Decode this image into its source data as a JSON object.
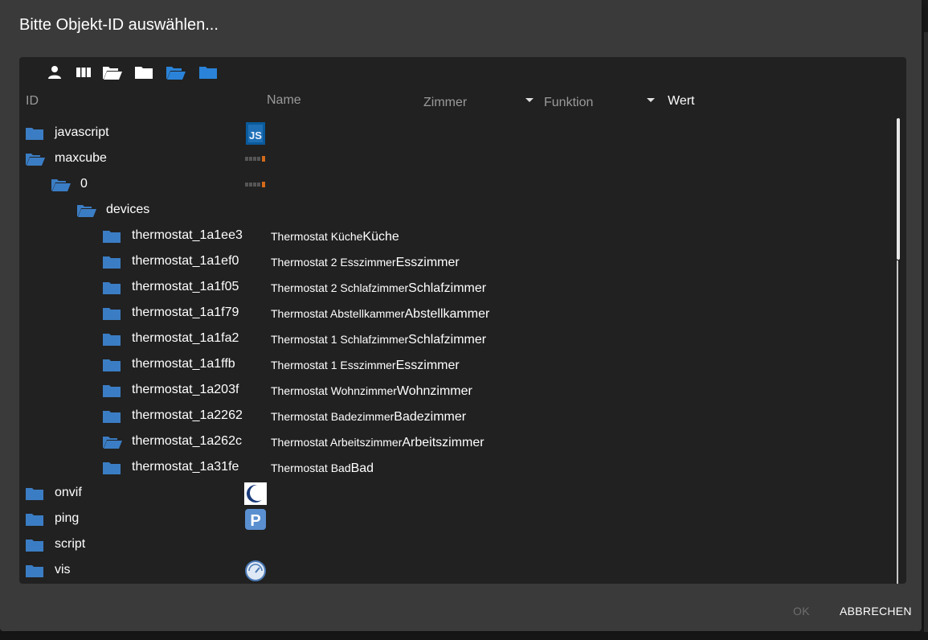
{
  "dialog": {
    "title": "Bitte Objekt-ID auswählen...",
    "ok_label": "OK",
    "cancel_label": "ABBRECHEN"
  },
  "toolbar": {
    "buttons": [
      "person-icon",
      "columns-icon",
      "folder-open-icon",
      "folder-icon",
      "folder-open-blue-icon",
      "folder-blue-icon"
    ]
  },
  "columns": {
    "id": "ID",
    "name": "Name",
    "room": "Zimmer",
    "function": "Funktion",
    "value": "Wert"
  },
  "tree": [
    {
      "id": "javascript",
      "depth": 0,
      "open": false,
      "name": "",
      "room": "",
      "icon": "js-icon"
    },
    {
      "id": "maxcube",
      "depth": 0,
      "open": true,
      "name": "",
      "room": "",
      "icon": "maxcube-icon"
    },
    {
      "id": "0",
      "depth": 1,
      "open": true,
      "name": "",
      "room": "",
      "icon": "maxcube-icon"
    },
    {
      "id": "devices",
      "depth": 2,
      "open": true,
      "name": "",
      "room": "",
      "icon": ""
    },
    {
      "id": "thermostat_1a1ee3",
      "depth": 3,
      "open": false,
      "name": "Thermostat Küche",
      "room": "Küche",
      "icon": ""
    },
    {
      "id": "thermostat_1a1ef0",
      "depth": 3,
      "open": false,
      "name": "Thermostat 2 Esszimmer",
      "room": "Esszimmer",
      "icon": ""
    },
    {
      "id": "thermostat_1a1f05",
      "depth": 3,
      "open": false,
      "name": "Thermostat 2 Schlafzimmer",
      "room": "Schlafzimmer",
      "icon": ""
    },
    {
      "id": "thermostat_1a1f79",
      "depth": 3,
      "open": false,
      "name": "Thermostat Abstellkammer",
      "room": "Abstellkammer",
      "icon": ""
    },
    {
      "id": "thermostat_1a1fa2",
      "depth": 3,
      "open": false,
      "name": "Thermostat 1 Schlafzimmer",
      "room": "Schlafzimmer",
      "icon": ""
    },
    {
      "id": "thermostat_1a1ffb",
      "depth": 3,
      "open": false,
      "name": "Thermostat 1 Esszimmer",
      "room": "Esszimmer",
      "icon": ""
    },
    {
      "id": "thermostat_1a203f",
      "depth": 3,
      "open": false,
      "name": "Thermostat Wohnzimmer",
      "room": "Wohnzimmer",
      "icon": ""
    },
    {
      "id": "thermostat_1a2262",
      "depth": 3,
      "open": false,
      "name": "Thermostat Badezimmer",
      "room": "Badezimmer",
      "icon": ""
    },
    {
      "id": "thermostat_1a262c",
      "depth": 3,
      "open": true,
      "name": "Thermostat Arbeitszimmer",
      "room": "Arbeitszimmer",
      "icon": ""
    },
    {
      "id": "thermostat_1a31fe",
      "depth": 3,
      "open": false,
      "name": "Thermostat Bad",
      "room": "Bad",
      "icon": ""
    },
    {
      "id": "onvif",
      "depth": 0,
      "open": false,
      "name": "",
      "room": "",
      "icon": "onvif-icon"
    },
    {
      "id": "ping",
      "depth": 0,
      "open": false,
      "name": "",
      "room": "",
      "icon": "ping-icon"
    },
    {
      "id": "script",
      "depth": 0,
      "open": false,
      "name": "",
      "room": "",
      "icon": ""
    },
    {
      "id": "vis",
      "depth": 0,
      "open": false,
      "name": "",
      "room": "",
      "icon": "vis-icon"
    }
  ],
  "icon_text": {
    "js": "JS",
    "ping": "P"
  },
  "colors": {
    "folder": "#3b7dc4",
    "toolbar_white": "#ffffff",
    "toolbar_blue": "#2a83d8"
  }
}
